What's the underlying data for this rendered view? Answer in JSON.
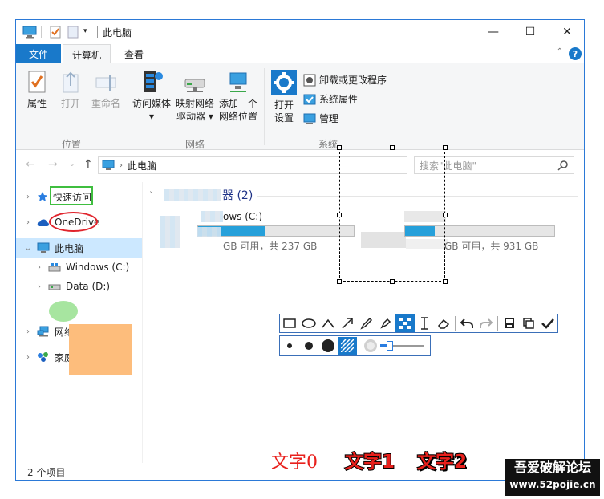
{
  "window": {
    "title": "此电脑",
    "controls": {
      "minimize": "—",
      "maximize": "☐",
      "close": "✕"
    }
  },
  "ribbon": {
    "tabs": [
      {
        "label": "文件"
      },
      {
        "label": "计算机"
      },
      {
        "label": "查看"
      }
    ],
    "help": "?",
    "groups": {
      "location": {
        "label": "位置",
        "items": {
          "properties": "属性",
          "open": "打开",
          "rename": "重命名"
        }
      },
      "network": {
        "label": "网络",
        "items": {
          "access_media": "访问媒体",
          "map_drive_1": "映射网络",
          "map_drive_2": "驱动器",
          "add_location_1": "添加一个",
          "add_location_2": "网络位置"
        }
      },
      "system": {
        "label": "系统",
        "items": {
          "open_settings_1": "打开",
          "open_settings_2": "设置",
          "uninstall": "卸载或更改程序",
          "system_properties": "系统属性",
          "manage": "管理"
        }
      }
    }
  },
  "address_bar": {
    "path": "此电脑",
    "search_placeholder": "搜索\"此电脑\""
  },
  "nav_pane": {
    "items": [
      {
        "label": "快速访问"
      },
      {
        "label": "OneDrive"
      },
      {
        "label": "此电脑"
      },
      {
        "label": "Windows (C:)"
      },
      {
        "label": "Data (D:)"
      },
      {
        "label": "网络"
      },
      {
        "label": "家庭组"
      }
    ]
  },
  "content": {
    "group_title_suffix": "器 (2)",
    "drives": [
      {
        "name_partial": "ows (C:)",
        "info_partial": "GB 可用，共 237 GB",
        "used_fraction": 0.43
      },
      {
        "name_partial": "",
        "info_partial": "GB 可用，共 931 GB",
        "used_fraction": 0.2
      }
    ]
  },
  "status_bar": {
    "count": "2 个项目"
  },
  "annotations": {
    "text0": "文字0",
    "text1": "文字1",
    "text2": "文字2"
  },
  "watermark": {
    "line1": "吾爱破解论坛",
    "line2": "www.52pojie.cn"
  },
  "colors": {
    "accent": "#1979ca",
    "selection": "#cce8ff",
    "drive_fill": "#26a0da",
    "annotation_red": "#e8201c",
    "annotation_green": "#3fbe3f",
    "annotation_orange": "#fdbd7c"
  }
}
